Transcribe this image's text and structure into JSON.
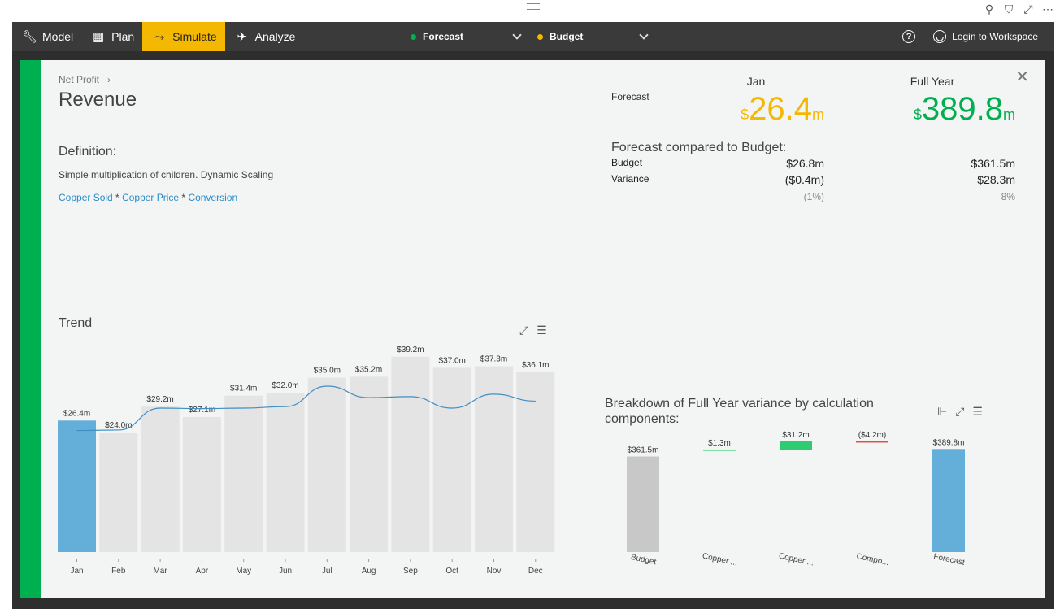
{
  "toolbar": {
    "nav": [
      {
        "label": "Model",
        "icon": "wrench-icon"
      },
      {
        "label": "Plan",
        "icon": "table-icon"
      },
      {
        "label": "Simulate",
        "icon": "branch-icon"
      },
      {
        "label": "Analyze",
        "icon": "telescope-icon"
      }
    ],
    "active": "Simulate",
    "scenario1": {
      "label": "Forecast",
      "color": "#00b050"
    },
    "scenario2": {
      "label": "Budget",
      "color": "#f5b800"
    },
    "login": "Login to Workspace"
  },
  "detail": {
    "breadcrumb": "Net Profit",
    "title": "Revenue",
    "definition_heading": "Definition:",
    "definition_text": "Simple multiplication of children. Dynamic Scaling",
    "formula": {
      "a": "Copper Sold",
      "op1": " * ",
      "b": "Copper Price",
      "op2": " * ",
      "c": "Conversion"
    },
    "trend_heading": "Trend",
    "forecast_label": "Forecast",
    "col_jan": "Jan",
    "col_fy": "Full Year",
    "jan_value": {
      "currency": "$",
      "number": "26.4",
      "suffix": "m",
      "color": "#f5b800"
    },
    "fy_value": {
      "currency": "$",
      "number": "389.8",
      "suffix": "m",
      "color": "#00b050"
    },
    "compare_heading": "Forecast compared to Budget:",
    "budget_label": "Budget",
    "variance_label": "Variance",
    "jan_budget": "$26.8m",
    "jan_variance": "($0.4m)",
    "jan_pct": "(1%)",
    "fy_budget": "$361.5m",
    "fy_variance": "$28.3m",
    "fy_pct": "8%",
    "breakdown_heading": "Breakdown of Full Year variance by calculation components:"
  },
  "chart_data": [
    {
      "type": "bar",
      "title": "Trend",
      "categories": [
        "Jan",
        "Feb",
        "Mar",
        "Apr",
        "May",
        "Jun",
        "Jul",
        "Aug",
        "Sep",
        "Oct",
        "Nov",
        "Dec"
      ],
      "values": [
        26.4,
        24.0,
        29.2,
        27.1,
        31.4,
        32.0,
        35.0,
        35.2,
        39.2,
        37.0,
        37.3,
        36.1
      ],
      "data_labels": [
        "$26.4m",
        "$24.0m",
        "$29.2m",
        "$27.1m",
        "$31.4m",
        "$32.0m",
        "$35.0m",
        "$35.2m",
        "$39.2m",
        "$37.0m",
        "$37.3m",
        "$36.1m"
      ],
      "highlight_index": 0,
      "highlight_color": "#63afd9",
      "bar_color": "#e4e4e4",
      "line_series": [
        24.4,
        24.5,
        28.9,
        28.8,
        28.9,
        29.2,
        33.3,
        31.0,
        31.2,
        28.9,
        31.7,
        30.3
      ],
      "line_color": "#3f8fc4",
      "ylim": [
        0,
        40
      ]
    },
    {
      "type": "bar",
      "subtype": "waterfall",
      "title": "Breakdown of Full Year variance by calculation components:",
      "categories": [
        "Budget",
        "Copper ...",
        "Copper ...",
        "Compo...",
        "Forecast"
      ],
      "values": [
        361.5,
        1.3,
        31.2,
        -4.2,
        389.8
      ],
      "data_labels": [
        "$361.5m",
        "$1.3m",
        "$31.2m",
        "($4.2m)",
        "$389.8m"
      ],
      "colors": [
        "#c8c8c8",
        "#2ecc71",
        "#2ecc71",
        "#e74c3c",
        "#63afd9"
      ],
      "ylim": [
        0,
        400
      ]
    }
  ]
}
